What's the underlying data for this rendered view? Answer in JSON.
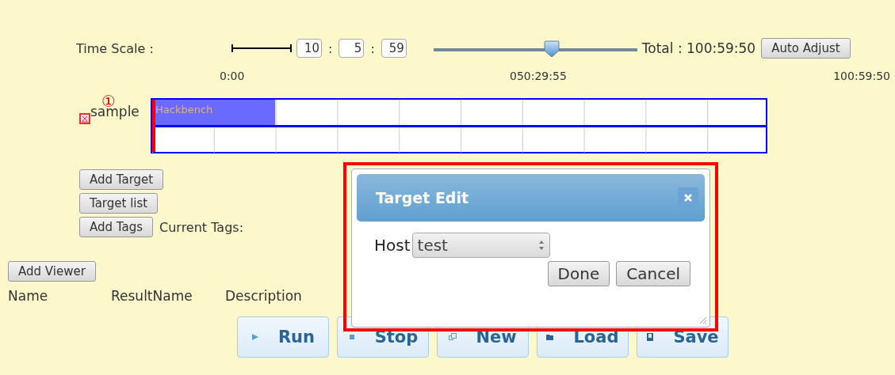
{
  "time_scale": {
    "label": "Time Scale :",
    "hours": "10",
    "separator_1": ":",
    "minutes": "5",
    "separator_2": ":",
    "seconds": "59",
    "zoom_slider": {
      "level": 0.58
    },
    "total": "Total : 100:59:50",
    "auto_adjust_button": "Auto Adjust"
  },
  "timeline": {
    "ticks": [
      "0:00",
      "050:29:55",
      "100:59:50"
    ],
    "tracks": [
      {
        "label": "sample",
        "marker": "①",
        "has_error_icon": true,
        "lanes": [
          {
            "kind": "bars",
            "bars": [
              {
                "label": "Hackbench",
                "level": 0.2
              }
            ]
          },
          {
            "kind": "blank"
          }
        ]
      }
    ]
  },
  "target_buttons": [
    "Add Target",
    "Target list"
  ],
  "tags": {
    "button": "Add Tags",
    "label": "Current Tags:"
  },
  "viewer": {
    "button": "Add Viewer",
    "columns": [
      "Name",
      "ResultName",
      "Description"
    ]
  },
  "actions": [
    {
      "kind": "run",
      "label": "Run"
    },
    {
      "kind": "stop",
      "label": "Stop"
    },
    {
      "kind": "new",
      "label": "New"
    },
    {
      "kind": "load",
      "label": "Load"
    },
    {
      "kind": "save",
      "label": "Save"
    }
  ],
  "dialog": {
    "title": "Target Edit",
    "highlighted": true,
    "host_label": "Host",
    "host_value": "test",
    "buttons": [
      "Done",
      "Cancel"
    ]
  }
}
